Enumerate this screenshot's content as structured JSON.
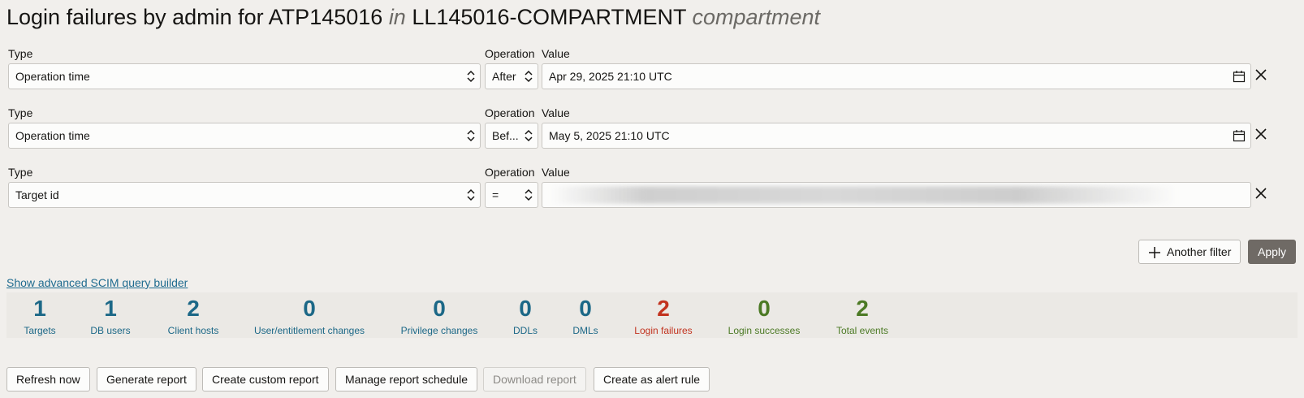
{
  "header": {
    "prefix": "Login failures by admin for ATP145016",
    "in_word": "in",
    "compartment_name": "LL145016-COMPARTMENT",
    "suffix": "compartment"
  },
  "filters": [
    {
      "type_label": "Type",
      "operation_label": "Operation",
      "value_label": "Value",
      "type": "Operation time",
      "operation": "After",
      "value": "Apr 29, 2025 21:10 UTC",
      "value_icon": "calendar-icon"
    },
    {
      "type_label": "Type",
      "operation_label": "Operation",
      "value_label": "Value",
      "type": "Operation time",
      "operation": "Bef...",
      "value": "May 5, 2025 21:10 UTC",
      "value_icon": "calendar-icon"
    },
    {
      "type_label": "Type",
      "operation_label": "Operation",
      "value_label": "Value",
      "type": "Target id",
      "operation": "=",
      "value": "",
      "value_icon": ""
    }
  ],
  "actions": {
    "another_filter": "Another filter",
    "apply": "Apply"
  },
  "advanced_link": "Show advanced SCIM query builder",
  "stats": [
    {
      "value": "1",
      "label": "Targets",
      "color": "#1c6887"
    },
    {
      "value": "1",
      "label": "DB users",
      "color": "#1c6887"
    },
    {
      "value": "2",
      "label": "Client hosts",
      "color": "#1c6887"
    },
    {
      "value": "0",
      "label": "User/entitlement changes",
      "color": "#1c6887"
    },
    {
      "value": "0",
      "label": "Privilege changes",
      "color": "#1c6887"
    },
    {
      "value": "0",
      "label": "DDLs",
      "color": "#1c6887"
    },
    {
      "value": "0",
      "label": "DMLs",
      "color": "#1c6887"
    },
    {
      "value": "2",
      "label": "Login failures",
      "color": "#c2331f"
    },
    {
      "value": "0",
      "label": "Login successes",
      "color": "#4c7a25"
    },
    {
      "value": "2",
      "label": "Total events",
      "color": "#4c7a25"
    }
  ],
  "bottom_buttons": {
    "refresh": "Refresh now",
    "generate": "Generate report",
    "custom": "Create custom report",
    "schedule": "Manage report schedule",
    "download": "Download report",
    "alert": "Create as alert rule"
  }
}
